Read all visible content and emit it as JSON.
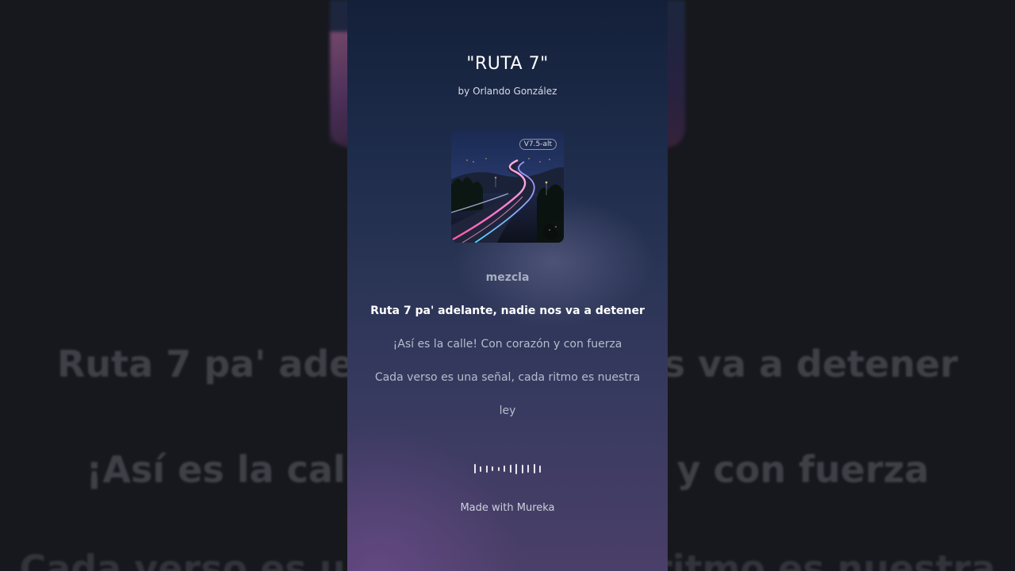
{
  "song": {
    "title": "\"RUTA 7\"",
    "artist_line": "by Orlando González",
    "cover_badge": "V7.5-alt"
  },
  "lyrics": {
    "section": "mezcla",
    "line1": "Ruta 7 pa' adelante, nadie nos va a detener",
    "line2": "¡Así es la calle! Con corazón y con fuerza",
    "line3": "Cada verso es una señal, cada ritmo es nuestra",
    "line4": "ley"
  },
  "background_lyrics": {
    "line1": "Ruta 7 pa' adelante, nadie nos va a detener",
    "line2": "¡Así es la calle! Con corazón y con fuerza",
    "line3": "Cada verso es una señal, cada ritmo es nuestra"
  },
  "footer": {
    "credit": "Made with Mureka"
  },
  "colors": {
    "active_lyric": "#ffffff",
    "inactive_lyric": "#b6bccd",
    "road_glow_pink": "#ff4fa3",
    "road_glow_cyan": "#5fd8ff"
  },
  "icons": {
    "waveform": "audio-waveform-icon"
  }
}
